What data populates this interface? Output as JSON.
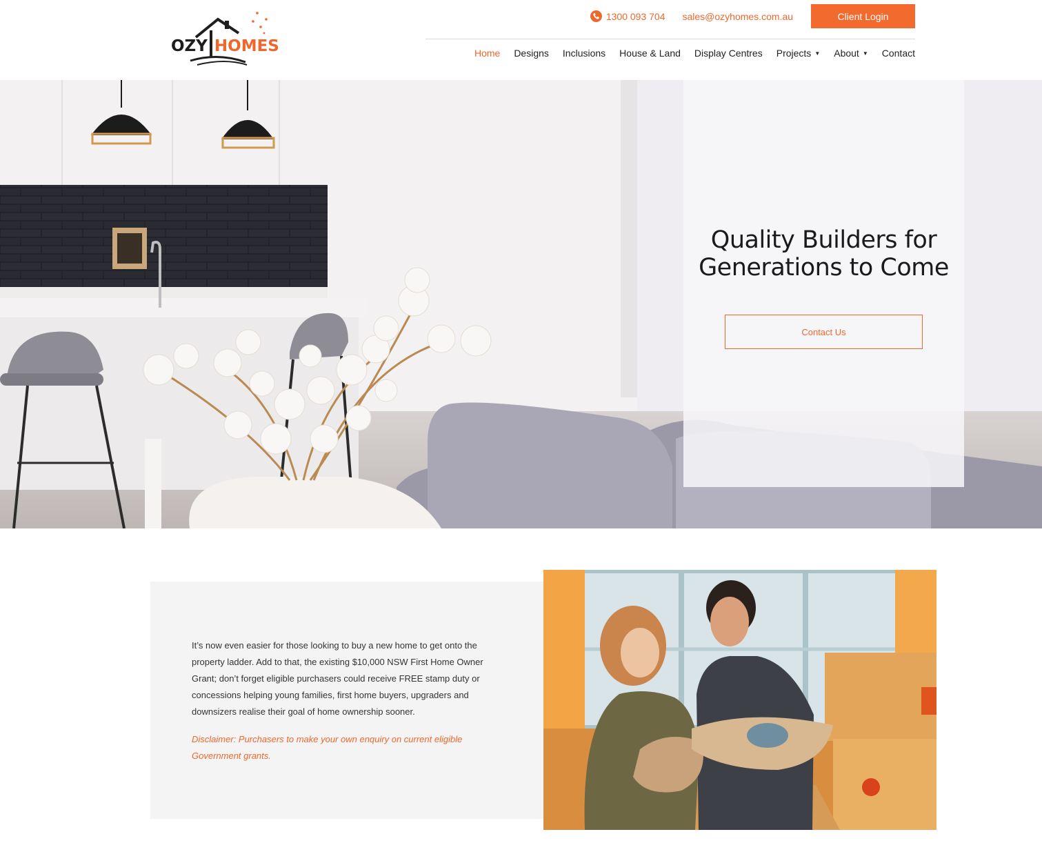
{
  "header": {
    "logo": {
      "word_left": "OZY",
      "word_right": "HOMES"
    },
    "phone": "1300 093 704",
    "email": "sales@ozyhomes.com.au",
    "client_login_label": "Client Login",
    "nav": [
      {
        "label": "Home",
        "active": true,
        "has_dropdown": false
      },
      {
        "label": "Designs",
        "active": false,
        "has_dropdown": false
      },
      {
        "label": "Inclusions",
        "active": false,
        "has_dropdown": false
      },
      {
        "label": "House & Land",
        "active": false,
        "has_dropdown": false
      },
      {
        "label": "Display Centres",
        "active": false,
        "has_dropdown": false
      },
      {
        "label": "Projects",
        "active": false,
        "has_dropdown": true
      },
      {
        "label": "About",
        "active": false,
        "has_dropdown": true
      },
      {
        "label": "Contact",
        "active": false,
        "has_dropdown": false
      }
    ]
  },
  "hero": {
    "title_line1": "Quality Builders for",
    "title_line2": "Generations to Come",
    "cta_label": "Contact Us"
  },
  "info": {
    "body": "It’s now even easier for those looking to buy a new home to get onto the property ladder. Add to that, the existing $10,000 NSW First Home Owner Grant; don’t forget eligible purchasers could receive FREE stamp duty or concessions helping young families, first home buyers, upgraders and downsizers realise their goal of home ownership sooner.",
    "disclaimer": "Disclaimer: Purchasers to make your own enquiry on current eligible Government grants."
  },
  "colors": {
    "accent": "#f0672b",
    "text": "#222222",
    "panel": "#f4f4f4"
  },
  "icons": {
    "phone": "phone-icon",
    "dropdown": "caret-down-icon"
  }
}
